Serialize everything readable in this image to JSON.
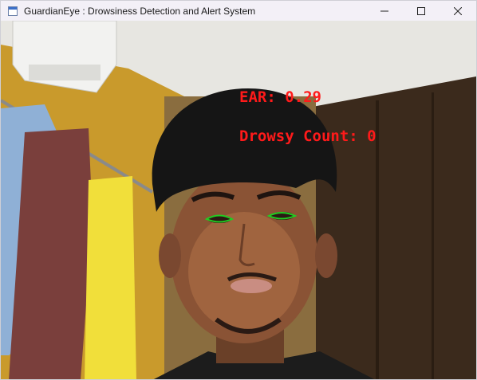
{
  "window": {
    "title": "GuardianEye : Drowsiness Detection and Alert System",
    "icon": "app-window-icon",
    "controls": [
      "minimize-icon",
      "maximize-icon",
      "close-icon"
    ]
  },
  "overlay": {
    "ear_label": "EAR:",
    "ear_value": "0.29",
    "drowsy_label": "Drowsy Count:",
    "drowsy_value": "0",
    "text_color": "#ff1a1a",
    "eye_contour_color": "#22cc22"
  },
  "colors": {
    "titlebar_bg": "#f3f0f7"
  }
}
